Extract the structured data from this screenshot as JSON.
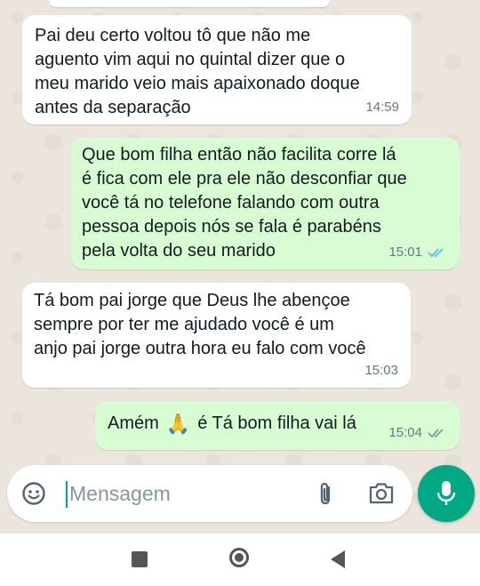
{
  "messages": [
    {
      "direction": "incoming",
      "lines": [
        "Pai deu certo voltou tô que não me",
        "aguento vim aqui no quintal dizer que o",
        "meu marido veio mais apaixonado doque",
        "antes da separação"
      ],
      "time": "14:59"
    },
    {
      "direction": "outgoing",
      "lines": [
        "Que bom filha então não facilita corre lá",
        "é fica com ele pra ele não desconfiar que",
        "você tá no telefone falando com outra",
        "pessoa depois nós se fala é parabéns",
        "pela volta do seu marido"
      ],
      "time": "15:01",
      "status": "read",
      "status_color": "#53bdeb"
    },
    {
      "direction": "incoming",
      "lines": [
        "Tá bom pai jorge que Deus lhe abençoe",
        "sempre por ter me ajudado você é um",
        "anjo pai jorge outra hora eu falo com você"
      ],
      "time": "15:03"
    },
    {
      "direction": "outgoing",
      "text_before_emoji": "Amém",
      "emoji": "🙏",
      "text_after_emoji": "é Tá bom filha vai lá",
      "time": "15:04",
      "status": "delivered",
      "status_color": "#8696a0"
    }
  ],
  "composer": {
    "placeholder": "Mensagem",
    "emoji_icon": "sticker-smile-icon",
    "attach_icon": "paperclip-icon",
    "camera_icon": "camera-icon",
    "mic_icon": "microphone-icon"
  },
  "colors": {
    "incoming_bubble": "#ffffff",
    "outgoing_bubble": "#d9fdd3",
    "accent": "#00a884",
    "wallpaper": "#ece5dd"
  },
  "navigation": {
    "recents_icon": "square-icon",
    "home_icon": "circle-home-icon",
    "back_icon": "triangle-back-icon"
  }
}
